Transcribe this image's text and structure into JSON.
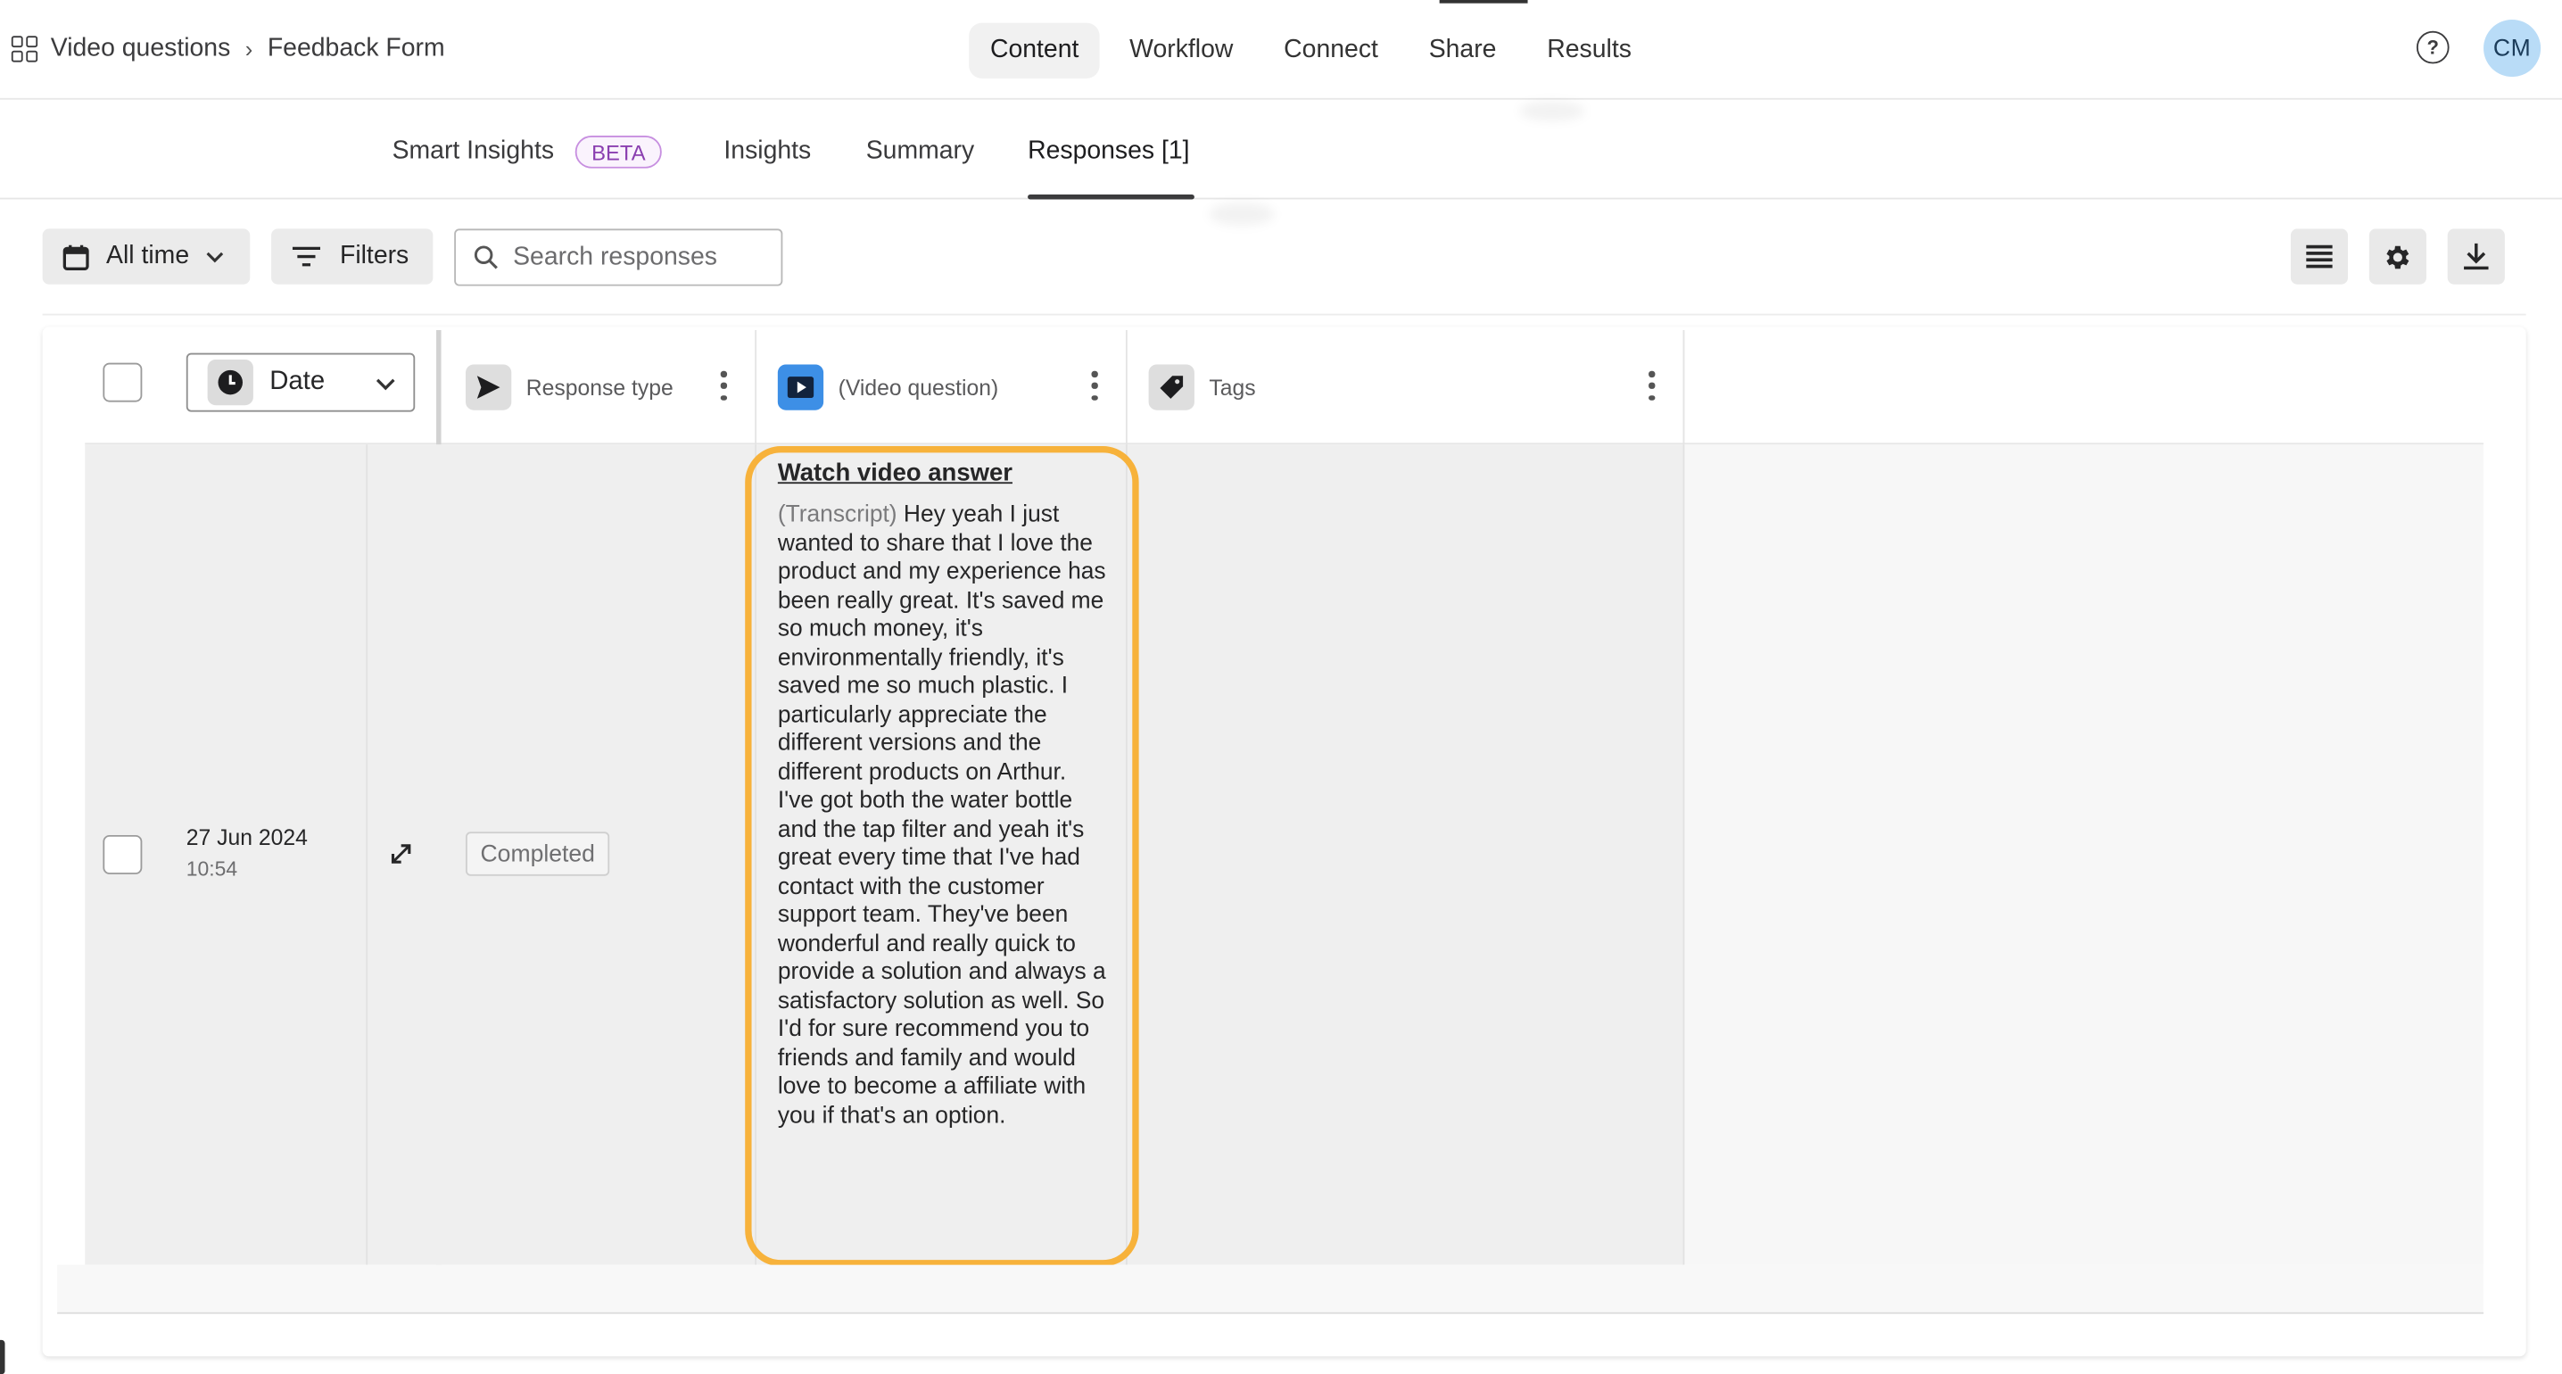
{
  "breadcrumb": {
    "parent": "Video questions",
    "current": "Feedback Form"
  },
  "main_tabs": [
    {
      "label": "Content",
      "active": true
    },
    {
      "label": "Workflow",
      "active": false
    },
    {
      "label": "Connect",
      "active": false
    },
    {
      "label": "Share",
      "active": false
    },
    {
      "label": "Results",
      "active": false
    }
  ],
  "header": {
    "help_label": "?",
    "avatar_initials": "CM",
    "avatar_color": "#b9dcf7"
  },
  "sub_tabs": {
    "smart_insights": "Smart Insights",
    "beta_badge": "BETA",
    "insights": "Insights",
    "summary": "Summary",
    "responses": "Responses [1]",
    "active": "Responses [1]"
  },
  "toolbar": {
    "time_filter": "All time",
    "filters": "Filters",
    "search_placeholder": "Search responses",
    "search_value": ""
  },
  "table": {
    "sort_select": "Date",
    "columns": [
      {
        "label": "Response type",
        "icon": "send-icon"
      },
      {
        "label": "(Video question)",
        "icon": "video-play-icon",
        "icon_color": "#3d8fe6"
      },
      {
        "label": "Tags",
        "icon": "tag-icon"
      }
    ],
    "rows": [
      {
        "date": "27 Jun 2024",
        "time": "10:54",
        "status": "Completed",
        "video_link": "Watch video answer",
        "transcript_label": "(Transcript)",
        "transcript": "Hey yeah I just wanted to share that I love the product and my experience has been really great. It's saved me so much money, it's environmentally friendly, it's saved me so much plastic. I particularly appreciate the different versions and the different products on Arthur. I've got both the water bottle and the tap filter and yeah it's great every time that I've had contact with the customer support team. They've been wonderful and really quick to provide a solution and always a satisfactory solution as well. So I'd for sure recommend you to friends and family and would love to become a affiliate with you if that's an option.",
        "tags": ""
      }
    ]
  },
  "highlight_color": "#f7b23b"
}
